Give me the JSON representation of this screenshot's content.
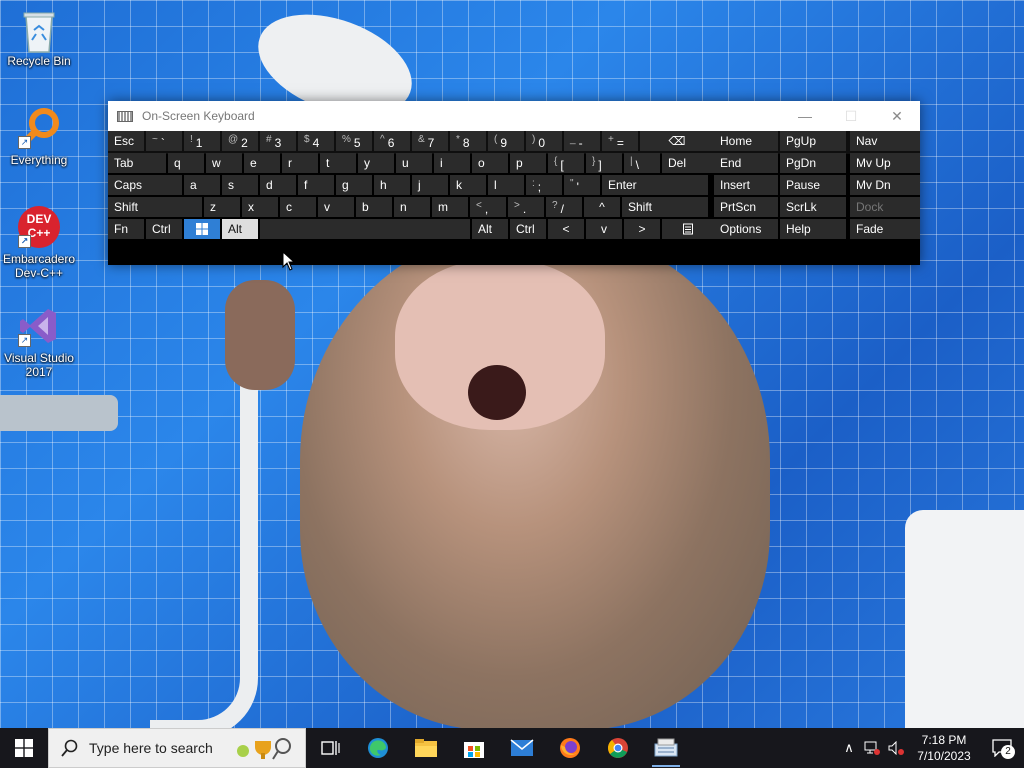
{
  "desktop_icons": [
    {
      "label": "Recycle Bin",
      "icon": "recycle-bin-icon"
    },
    {
      "label": "Everything",
      "icon": "magnifier-icon"
    },
    {
      "label": "Embarcadero\nDev-C++",
      "label_lines": [
        "Embarcadero",
        "Dev-C++"
      ],
      "icon": "devcpp-icon",
      "icon_text": "DEV\nC++"
    },
    {
      "label": "Visual Studio 2017",
      "label_lines": [
        "Visual Studio",
        "2017"
      ],
      "icon": "visual-studio-icon"
    }
  ],
  "osk": {
    "title": "On-Screen Keyboard",
    "rows": [
      [
        {
          "name": "esc",
          "label": "Esc"
        },
        {
          "name": "tilde",
          "shift": "~",
          "main": "`"
        },
        {
          "name": "1",
          "shift": "!",
          "main": "1"
        },
        {
          "name": "2",
          "shift": "@",
          "main": "2"
        },
        {
          "name": "3",
          "shift": "#",
          "main": "3"
        },
        {
          "name": "4",
          "shift": "$",
          "main": "4"
        },
        {
          "name": "5",
          "shift": "%",
          "main": "5"
        },
        {
          "name": "6",
          "shift": "^",
          "main": "6"
        },
        {
          "name": "7",
          "shift": "&",
          "main": "7"
        },
        {
          "name": "8",
          "shift": "*",
          "main": "8"
        },
        {
          "name": "9",
          "shift": "(",
          "main": "9"
        },
        {
          "name": "0",
          "shift": ")",
          "main": "0"
        },
        {
          "name": "minus",
          "shift": "_",
          "main": "-"
        },
        {
          "name": "equals",
          "shift": "+",
          "main": "="
        },
        {
          "name": "backspace",
          "label": "⌫"
        }
      ],
      [
        {
          "name": "tab",
          "label": "Tab"
        },
        {
          "name": "q",
          "label": "q"
        },
        {
          "name": "w",
          "label": "w"
        },
        {
          "name": "e",
          "label": "e"
        },
        {
          "name": "r",
          "label": "r"
        },
        {
          "name": "t",
          "label": "t"
        },
        {
          "name": "y",
          "label": "y"
        },
        {
          "name": "u",
          "label": "u"
        },
        {
          "name": "i",
          "label": "i"
        },
        {
          "name": "o",
          "label": "o"
        },
        {
          "name": "p",
          "label": "p"
        },
        {
          "name": "lbracket",
          "shift": "{",
          "main": "["
        },
        {
          "name": "rbracket",
          "shift": "}",
          "main": "]"
        },
        {
          "name": "backslash",
          "shift": "|",
          "main": "\\"
        },
        {
          "name": "del",
          "label": "Del"
        }
      ],
      [
        {
          "name": "caps",
          "label": "Caps"
        },
        {
          "name": "a",
          "label": "a"
        },
        {
          "name": "s",
          "label": "s"
        },
        {
          "name": "d",
          "label": "d"
        },
        {
          "name": "f",
          "label": "f"
        },
        {
          "name": "g",
          "label": "g"
        },
        {
          "name": "h",
          "label": "h"
        },
        {
          "name": "j",
          "label": "j"
        },
        {
          "name": "k",
          "label": "k"
        },
        {
          "name": "l",
          "label": "l"
        },
        {
          "name": "semicolon",
          "shift": ":",
          "main": ";"
        },
        {
          "name": "quote",
          "shift": "\"",
          "main": "'"
        },
        {
          "name": "enter",
          "label": "Enter"
        }
      ],
      [
        {
          "name": "lshift",
          "label": "Shift"
        },
        {
          "name": "z",
          "label": "z"
        },
        {
          "name": "x",
          "label": "x"
        },
        {
          "name": "c",
          "label": "c"
        },
        {
          "name": "v",
          "label": "v"
        },
        {
          "name": "b",
          "label": "b"
        },
        {
          "name": "n",
          "label": "n"
        },
        {
          "name": "m",
          "label": "m"
        },
        {
          "name": "comma",
          "shift": "<",
          "main": ","
        },
        {
          "name": "period",
          "shift": ">",
          "main": "."
        },
        {
          "name": "slash",
          "shift": "?",
          "main": "/"
        },
        {
          "name": "up",
          "label": "^"
        },
        {
          "name": "rshift",
          "label": "Shift"
        }
      ],
      [
        {
          "name": "fn",
          "label": "Fn"
        },
        {
          "name": "lctrl",
          "label": "Ctrl"
        },
        {
          "name": "win",
          "label": ""
        },
        {
          "name": "lalt",
          "label": "Alt"
        },
        {
          "name": "space",
          "label": ""
        },
        {
          "name": "ralt",
          "label": "Alt"
        },
        {
          "name": "rctrl",
          "label": "Ctrl"
        },
        {
          "name": "left",
          "label": "<"
        },
        {
          "name": "down",
          "label": "v"
        },
        {
          "name": "right",
          "label": ">"
        },
        {
          "name": "menu",
          "label": ""
        }
      ]
    ],
    "nav_keys": [
      [
        "Home",
        "PgUp",
        "Nav"
      ],
      [
        "End",
        "PgDn",
        "Mv Up"
      ],
      [
        "Insert",
        "Pause",
        "Mv Dn"
      ],
      [
        "PrtScn",
        "ScrLk",
        "Dock"
      ],
      [
        "Options",
        "Help",
        "Fade"
      ]
    ],
    "active_keys": [
      "win"
    ],
    "pressed_keys": [
      "lalt"
    ],
    "disabled_keys": [
      "Dock"
    ]
  },
  "taskbar": {
    "search_placeholder": "Type here to search",
    "apps": [
      "task-view-icon",
      "edge-icon",
      "file-explorer-icon",
      "store-icon",
      "mail-icon",
      "firefox-icon",
      "chrome-icon",
      "on-screen-keyboard-icon"
    ],
    "running_app": "on-screen-keyboard-icon",
    "time": "7:18 PM",
    "date": "7/10/2023",
    "notification_count": "2"
  },
  "colors": {
    "taskbar": "#17171c",
    "key": "#2b2b2b",
    "key_active": "#2f7fd5",
    "key_pressed": "#dedede"
  }
}
